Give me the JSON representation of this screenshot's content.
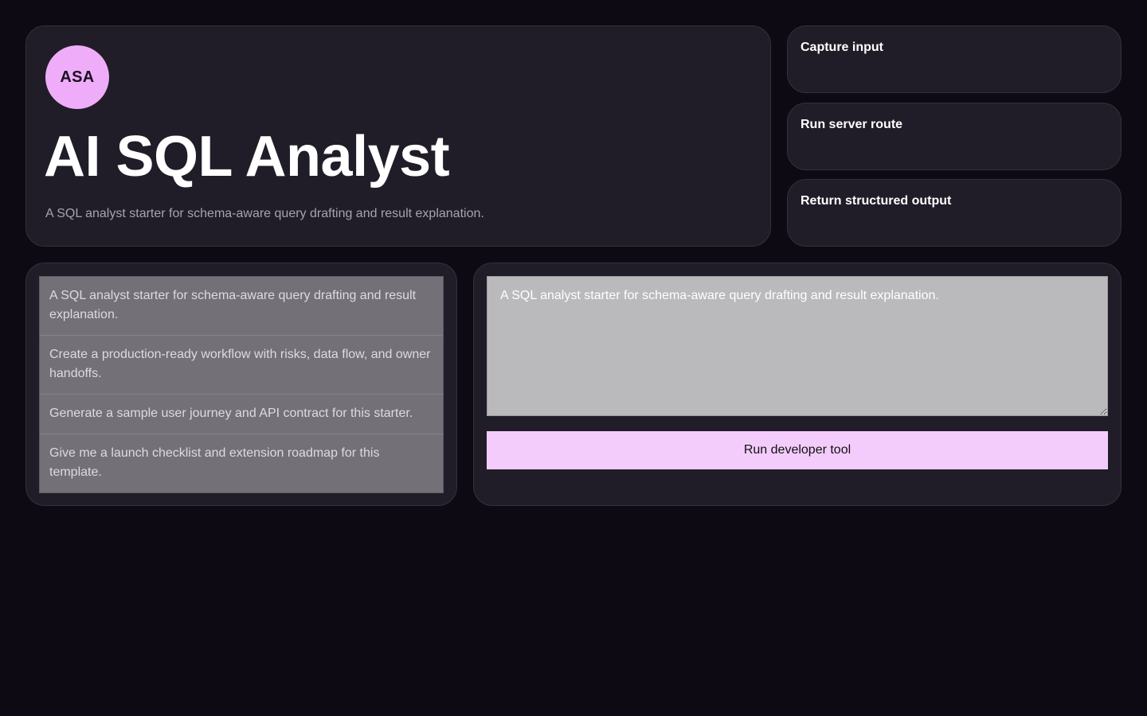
{
  "hero": {
    "avatar_initials": "ASA",
    "title": "AI SQL Analyst",
    "subtitle": "A SQL analyst starter for schema-aware query drafting and result explanation."
  },
  "steps": [
    {
      "label": "Capture input"
    },
    {
      "label": "Run server route"
    },
    {
      "label": "Return structured output"
    }
  ],
  "prompts": [
    {
      "text": "A SQL analyst starter for schema-aware query drafting and result explanation."
    },
    {
      "text": "Create a production-ready workflow with risks, data flow, and owner handoffs."
    },
    {
      "text": "Generate a sample user journey and API contract for this starter."
    },
    {
      "text": "Give me a launch checklist and extension roadmap for this template."
    }
  ],
  "tool": {
    "input_value": "A SQL analyst starter for schema-aware query drafting and result explanation.",
    "run_label": "Run developer tool"
  },
  "colors": {
    "background": "#0d0a14",
    "card": "#201d28",
    "accent": "#efadf9",
    "button": "#f4ccfc"
  }
}
